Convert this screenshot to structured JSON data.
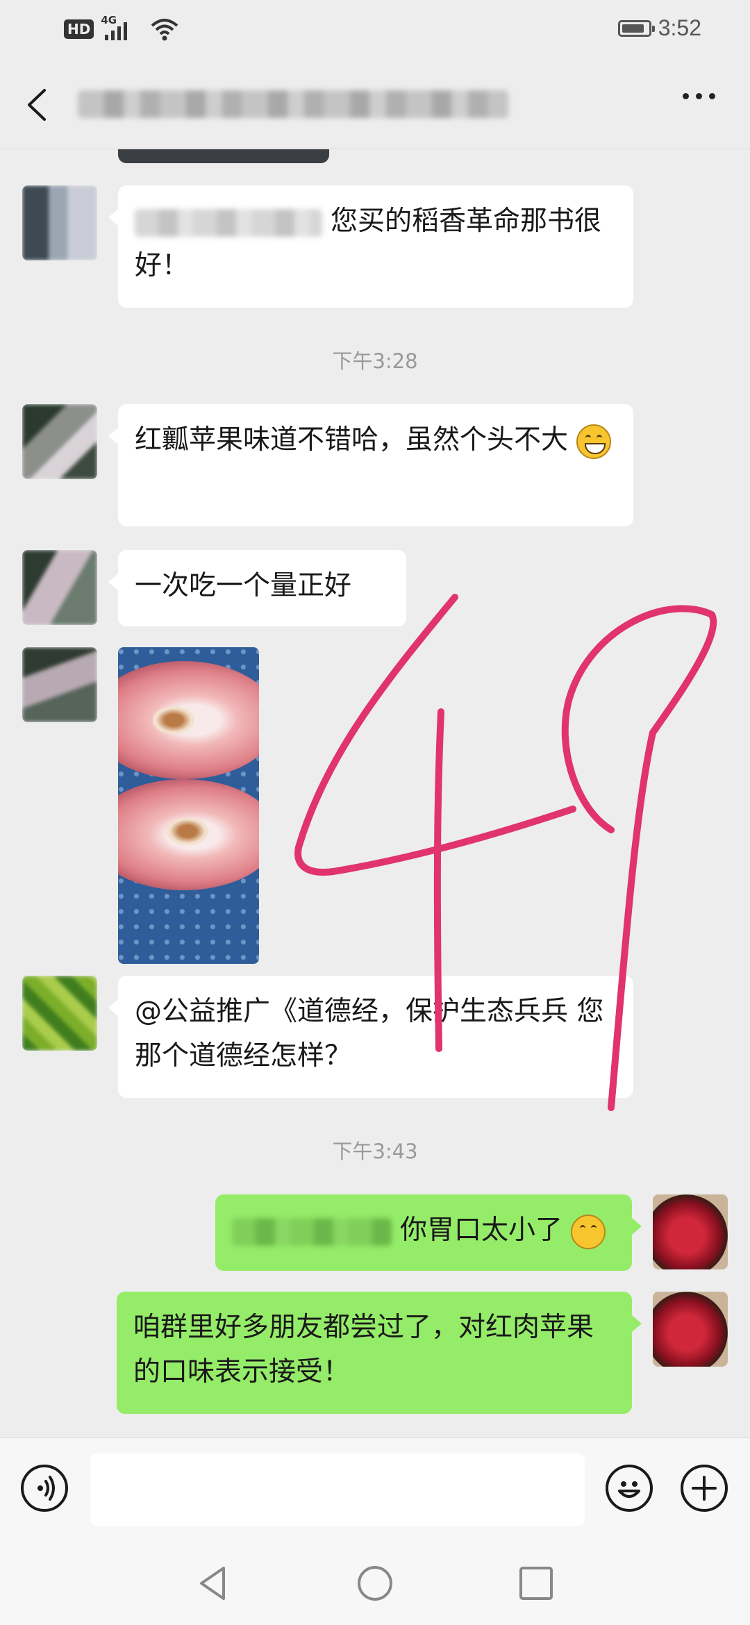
{
  "status_bar": {
    "hd_label": "HD",
    "network_label": "4G",
    "time": "3:52",
    "battery_level_fraction": 0.85
  },
  "header": {
    "back_icon": "chevron-left-icon",
    "more_icon": "more-dots-icon"
  },
  "messages": [
    {
      "side": "left",
      "text": "您买的稻香革命那书很好！"
    },
    {
      "side": "left",
      "text": "红瓤苹果味道不错哈，虽然个头不大"
    },
    {
      "side": "left",
      "text": "一次吃一个量正好"
    },
    {
      "side": "left",
      "type": "image"
    },
    {
      "side": "left",
      "text": "@公益推广《道德经，保护生态兵兵 您那个道德经怎样？"
    },
    {
      "side": "right",
      "text": "你胃口太小了"
    },
    {
      "side": "right",
      "text": "咱群里好多朋友都尝过了，对红肉苹果的口味表示接受！"
    }
  ],
  "timestamps": [
    "下午3:28",
    "下午3:43"
  ],
  "annotation": {
    "handwritten": "49",
    "color": "#e0336f"
  },
  "input_bar": {
    "voice_icon": "voice-icon",
    "emoji_icon": "emoji-icon",
    "plus_icon": "plus-icon",
    "value": ""
  },
  "colors": {
    "background": "#ededed",
    "incoming_bubble": "#ffffff",
    "outgoing_bubble": "#95ec69",
    "timestamp": "#999999"
  }
}
